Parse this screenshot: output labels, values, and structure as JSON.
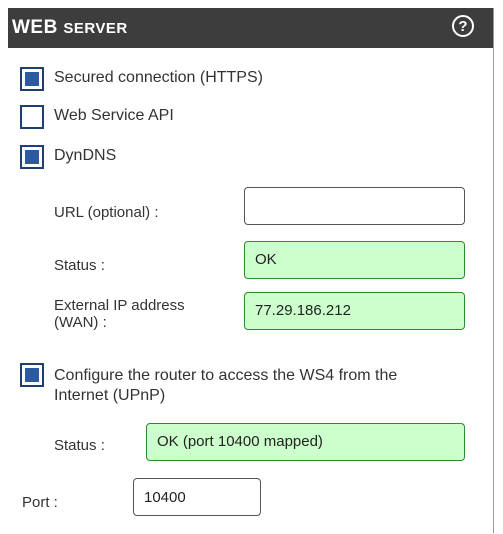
{
  "header": {
    "title_big": "WEB",
    "title_small": "SERVER",
    "help_label": "?"
  },
  "options": {
    "https": {
      "label": "Secured connection (HTTPS)",
      "checked": true
    },
    "ws_api": {
      "label": "Web Service API",
      "checked": false
    },
    "dyndns": {
      "label": "DynDNS",
      "checked": true
    },
    "upnp": {
      "label_line1": "Configure the router to access the WS4 from the",
      "label_line2": "Internet (UPnP)",
      "checked": true
    }
  },
  "dyndns": {
    "url_label": "URL (optional) :",
    "url_value": "",
    "status_label": "Status :",
    "status_value": "OK",
    "ext_ip_label_line1": "External IP address",
    "ext_ip_label_line2": "(WAN) :",
    "ext_ip_value": "77.29.186.212"
  },
  "upnp": {
    "status_label": "Status :",
    "status_value": "OK (port 10400 mapped)"
  },
  "port": {
    "label": "Port :",
    "value": "10400"
  },
  "colors": {
    "header_bg": "#3d3d3d",
    "checkbox_fill": "#2b5aa0",
    "status_bg": "#ccffcc",
    "status_border": "#2d8a2d"
  }
}
